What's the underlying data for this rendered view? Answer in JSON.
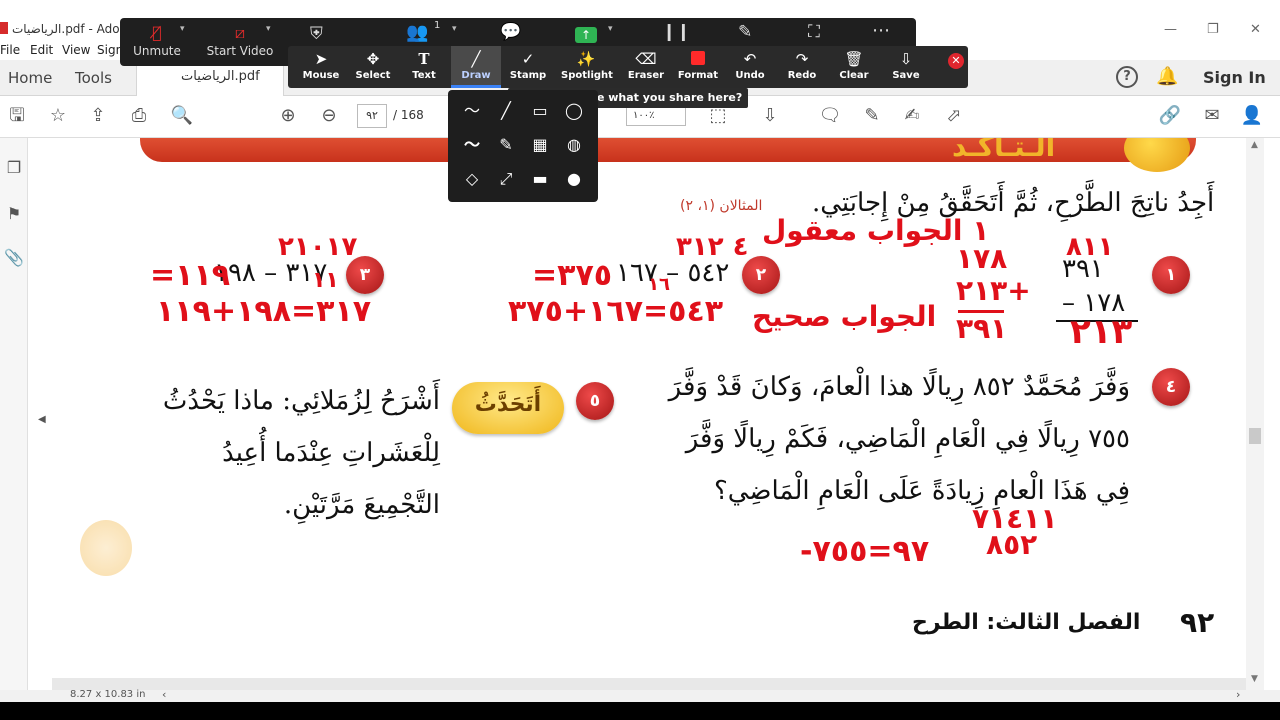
{
  "window": {
    "title": "الرياضيات.pdf - Adobe",
    "controls": {
      "minimize": "—",
      "restore": "❐",
      "close": "✕"
    }
  },
  "menubar": {
    "items": [
      "File",
      "Edit",
      "View",
      "Sign"
    ]
  },
  "acrobat": {
    "tabs": {
      "home": "Home",
      "tools": "Tools",
      "document": "الرياضيات.pdf"
    },
    "sign_in": "Sign In",
    "page": {
      "current": "٩٢",
      "total": "/ 168"
    },
    "zoom": "١٠٠٪",
    "page_size": "8.27 x 10.83 in"
  },
  "zoom_meeting": {
    "controls": [
      {
        "label": "Unmute",
        "icon": "microphone-muted-icon"
      },
      {
        "label": "Start Video",
        "icon": "video-off-icon"
      },
      {
        "label": "",
        "icon": "shield-icon"
      },
      {
        "label": "",
        "icon": "participants-icon",
        "count": "1"
      },
      {
        "label": "",
        "icon": "chat-icon"
      },
      {
        "label": "",
        "icon": "share-screen-icon"
      },
      {
        "label": "",
        "icon": "pause-share-icon"
      },
      {
        "label": "",
        "icon": "annotate-icon"
      },
      {
        "label": "",
        "icon": "remote-control-icon"
      },
      {
        "label": "",
        "icon": "more-icon"
      }
    ],
    "annotation_tools": [
      {
        "label": "Mouse",
        "icon": "cursor-icon"
      },
      {
        "label": "Select",
        "icon": "move-icon"
      },
      {
        "label": "Text",
        "icon": "text-icon"
      },
      {
        "label": "Draw",
        "icon": "draw-icon",
        "active": true
      },
      {
        "label": "Stamp",
        "icon": "stamp-icon"
      },
      {
        "label": "Spotlight",
        "icon": "spotlight-icon"
      },
      {
        "label": "Eraser",
        "icon": "eraser-icon"
      },
      {
        "label": "Format",
        "icon": "format-icon"
      },
      {
        "label": "Undo",
        "icon": "undo-icon"
      },
      {
        "label": "Redo",
        "icon": "redo-icon"
      },
      {
        "label": "Clear",
        "icon": "clear-icon"
      },
      {
        "label": "Save",
        "icon": "save-icon"
      }
    ],
    "tooltip": "Who can see what you share here?"
  },
  "page_content": {
    "banner_text": "الـتـأكـد",
    "instruction": "أَجِدُ ناتِجَ الطَّرْحِ، ثُمَّ أَتَحَقَّقُ مِنْ إِجابَتِي.",
    "reference": "المثالان (١، ٢)",
    "q1": {
      "num": "١",
      "top": "٣٩١",
      "minus": "١٧٨ –"
    },
    "q2": {
      "num": "٢",
      "expr": "٥٤٢ – ١٦٧"
    },
    "q3": {
      "num": "٣",
      "expr": "٣١٧ – ١٩٨"
    },
    "q4": {
      "num": "٤",
      "line1": "وَفَّرَ مُحَمَّدٌ ٨٥٢ رِيالًا هذا الْعامَ، وَكانَ قَدْ وَفَّرَ",
      "line2": "٧٥٥ رِيالًا فِي الْعَامِ الْمَاضِي، فَكَمْ رِيالًا وَفَّرَ",
      "line3": "فِي هَذَا الْعامِ زِيادَةً عَلَى الْعَامِ الْمَاضِي؟"
    },
    "q5": {
      "num": "٥",
      "badge": "أَتَحَدَّثُ",
      "line1": "أَشْرَحُ لِزُمَلائِي: ماذا يَحْدُثُ",
      "line2": "لِلْعَشَراتِ عِنْدَما أُعِيدُ",
      "line3": "التَّجْمِيعَ مَرَّتَيْنِ."
    },
    "footer": {
      "page_number": "٩٢",
      "chapter": "الفصل الثالث: الطرح"
    }
  },
  "handwriting": {
    "q1_borrow": "٨١١",
    "q1_answer": "٢١٣",
    "q1_check_a": "١٧٨",
    "q1_check_b": "+٢١٣",
    "q1_check_sum": "٣٩١",
    "q1_reasonable": "١ الجواب معقول",
    "q1_correct": "الجواب صحيح",
    "q2_borrow": "٤ ٣١٢",
    "q2_borrow2": "١٦",
    "q2_result": "٣٧٥=",
    "q2_check": "٥٤٣=١٦٧+٣٧٥",
    "q3_borrow": "٢١٠١٧",
    "q3_borrow2": "١١",
    "q3_result": "١١٩=",
    "q3_check": "٣١٧=١٩٨+١١٩",
    "q4_borrow": "٧١٤١١",
    "q4_top": "٨٥٢",
    "q4_result": "٩٧=٧٥٥-"
  }
}
